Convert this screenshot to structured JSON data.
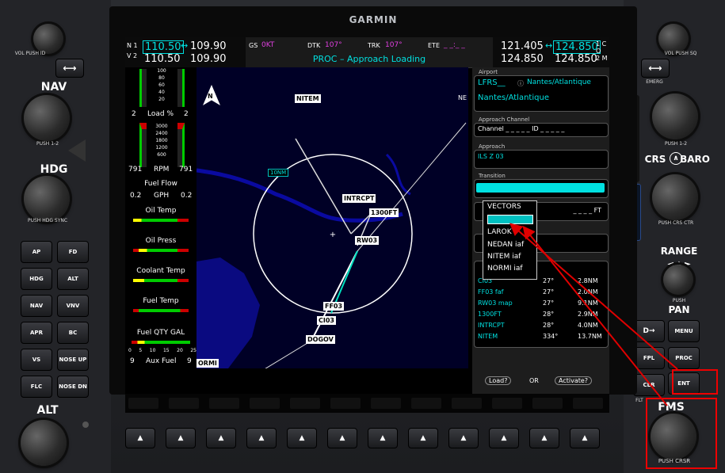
{
  "brand": "GARMIN",
  "nav": {
    "nav1_label": "N 1",
    "nav2_label": "V 2",
    "nav1_active": "110.50",
    "nav1_standby": "109.90",
    "nav2_active": "110.50",
    "nav2_standby": "109.90",
    "swap_glyph": "↔"
  },
  "com": {
    "com1_active": "121.405",
    "com1_standby": "124.850",
    "com2_active": "124.850",
    "com2_standby": "124.850",
    "com1_label": "1 C",
    "com2_label": "2 M",
    "com_mid": "O"
  },
  "status": {
    "gs_label": "GS",
    "gs_value": "0KT",
    "dtk_label": "DTK",
    "dtk_value": "107°",
    "trk_label": "TRK",
    "trk_value": "107°",
    "ete_label": "ETE",
    "ete_value": "_ _:_ _",
    "message": "PROC – Approach Loading"
  },
  "eis": {
    "load_ticks": [
      "100",
      "80",
      "60",
      "40",
      "20"
    ],
    "load_left": "2",
    "load_label": "Load %",
    "load_right": "2",
    "rpm_ticks": [
      "3000",
      "2400",
      "1800",
      "1200",
      "600"
    ],
    "rpm_left": "791",
    "rpm_label": "RPM",
    "rpm_right": "791",
    "fuel_flow_label": "Fuel Flow",
    "gph_left": "0.2",
    "gph_label": "GPH",
    "gph_right": "0.2",
    "oil_temp": "Oil Temp",
    "oil_press": "Oil Press",
    "coolant_temp": "Coolant Temp",
    "fuel_temp": "Fuel Temp",
    "fuel_qty": "Fuel QTY GAL",
    "fuel_qty_ticks": [
      "0",
      "5",
      "10",
      "15",
      "20",
      "25"
    ],
    "aux_left": "9",
    "aux_label": "Aux Fuel",
    "aux_right": "9"
  },
  "map": {
    "north": "N",
    "ne_label": "NE",
    "range": "10NM",
    "waypoints": {
      "nitem": "NITEM",
      "intrcpt": "INTRCPT",
      "alt1300": "1300FT",
      "rw03": "RW03",
      "ff03": "FF03",
      "ci03": "CI03",
      "dogov": "DOGOV",
      "normi": "ORMI"
    }
  },
  "proc": {
    "airport_label": "Airport",
    "airport_code": "LFRS__",
    "airport_name_short": "Nantes/Atlantique",
    "airport_name": "Nantes/Atlantique",
    "approach_channel_label": "Approach Channel",
    "channel_text": "Channel _ _ _ _ _  ID _ _ _ _ _",
    "approach_label": "Approach",
    "approach_value": "ILS Z 03",
    "transition_label": "Transition",
    "minimums_value": "_ _ _ _ FT",
    "dropdown": [
      "VECTORS",
      "",
      "LAROK",
      "NEDAN iaf",
      "NITEM iaf",
      "NORMI iaf"
    ],
    "legs": [
      {
        "wpt": "CI03",
        "dtk": "27°",
        "dis": "2.8NM"
      },
      {
        "wpt": "FF03 faf",
        "dtk": "27°",
        "dis": "2.0NM"
      },
      {
        "wpt": "RW03 map",
        "dtk": "27°",
        "dis": "9.1NM"
      },
      {
        "wpt": "1300FT",
        "dtk": "28°",
        "dis": "2.9NM"
      },
      {
        "wpt": "INTRCPT",
        "dtk": "28°",
        "dis": "4.0NM"
      },
      {
        "wpt": "NITEM",
        "dtk": "334°",
        "dis": "13.7NM"
      }
    ],
    "load_btn": "Load?",
    "or_text": "OR",
    "activate_btn": "Activate?"
  },
  "left_panel": {
    "vol_label": "VOL PUSH ID",
    "nav_label": "NAV",
    "nav_push": "PUSH 1-2",
    "hdg_label": "HDG",
    "hdg_push": "PUSH HDG SYNC",
    "alt_label": "ALT",
    "buttons": [
      "AP",
      "FD",
      "HDG",
      "ALT",
      "NAV",
      "VNV",
      "APR",
      "BC",
      "VS",
      "NOSE UP",
      "FLC",
      "NOSE DN"
    ]
  },
  "right_panel": {
    "vol_label": "VOL PUSH SQ",
    "emerg_label": "EMERG",
    "com_push": "PUSH 1-2",
    "crs_label": "CRS",
    "baro_label": "BARO",
    "crs_push": "PUSH CRS CTR",
    "range_label": "RANGE",
    "pan_push": "PUSH",
    "pan_label": "PAN",
    "buttons": [
      "D→",
      "MENU",
      "FPL",
      "PROC",
      "CLR",
      "ENT"
    ],
    "fms_label": "FMS",
    "fms_push": "PUSH CRSR",
    "fms_top": "FLT"
  },
  "colors": {
    "cyan": "#00e0e0",
    "magenta": "#e040e0",
    "annotation_red": "#e00000"
  }
}
